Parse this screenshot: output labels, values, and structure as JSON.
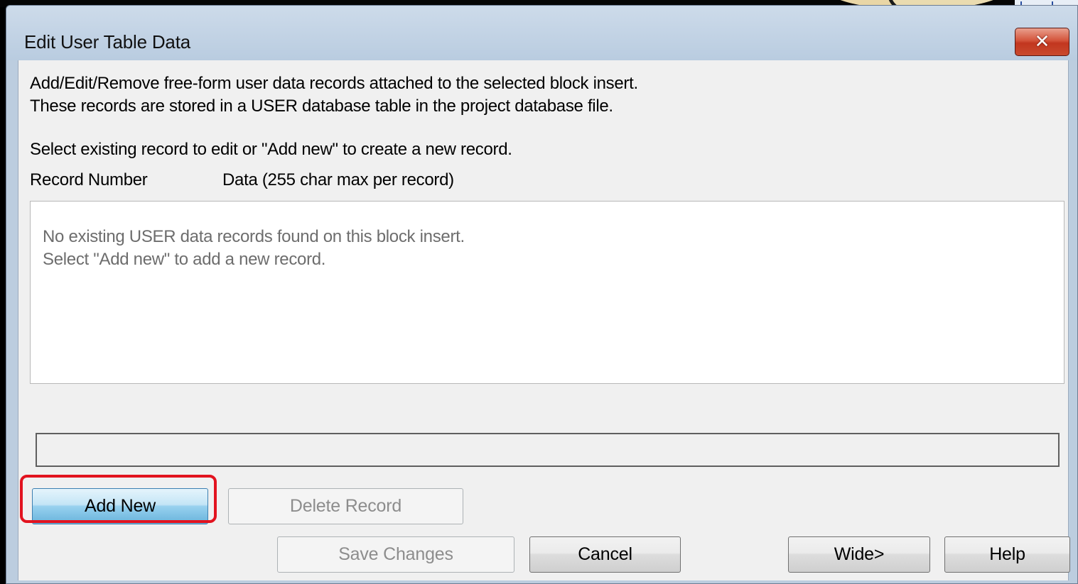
{
  "dialog": {
    "title": "Edit User Table Data",
    "close_label": "✕",
    "description": [
      "Add/Edit/Remove free-form user data records attached to the selected block insert.",
      "These records are stored in a USER database table in the project database file."
    ],
    "instruction": "Select existing record to edit or \"Add new\" to create a new record.",
    "columns": {
      "record_number": "Record Number",
      "data": "Data (255 char max per record)"
    },
    "records_message": [
      "No existing USER data records found on this block insert.",
      "Select \"Add new\" to add a new record."
    ],
    "edit_field_value": ""
  },
  "buttons": {
    "add_new": "Add New",
    "delete_record": "Delete Record",
    "save_changes": "Save Changes",
    "cancel": "Cancel",
    "wide": "Wide>",
    "help": "Help"
  },
  "colors": {
    "highlight": "#e2131f",
    "close_button": "#c94a2e",
    "primary_button": "#98d1ef"
  }
}
